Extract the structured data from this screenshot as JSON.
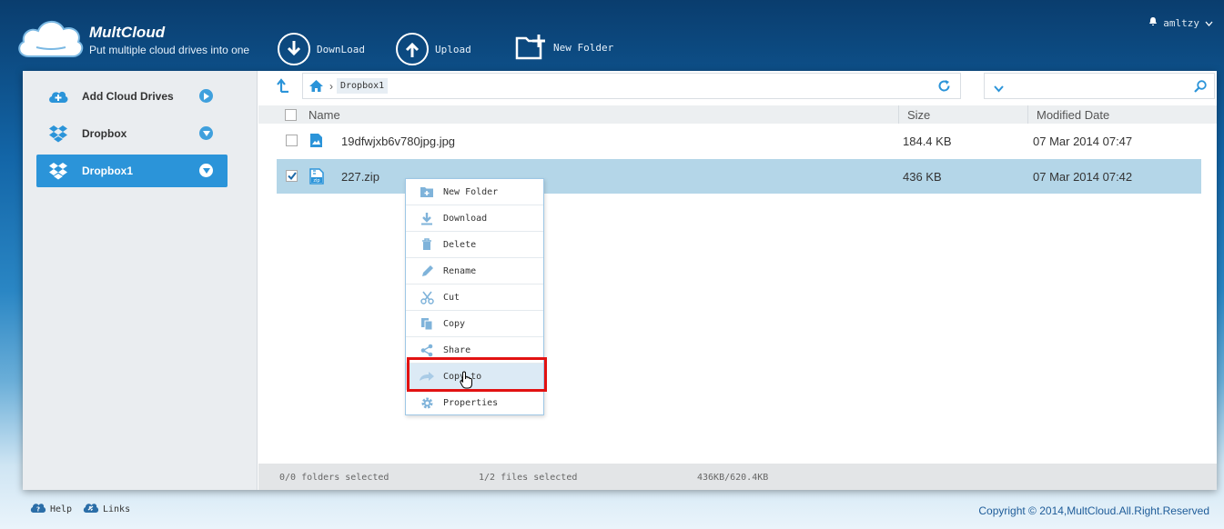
{
  "header": {
    "brand": "MultCloud",
    "tagline": "Put multiple cloud drives into one",
    "toolbar": [
      {
        "label": "DownLoad",
        "icon": "download-icon"
      },
      {
        "label": "Upload",
        "icon": "upload-icon"
      },
      {
        "label": "New Folder",
        "icon": "new-folder-icon"
      }
    ],
    "user": "amltzy"
  },
  "sidebar": {
    "items": [
      {
        "label": "Add Cloud Drives",
        "icon": "add-cloud-icon",
        "active": false
      },
      {
        "label": "Dropbox",
        "icon": "dropbox-icon",
        "active": false
      },
      {
        "label": "Dropbox1",
        "icon": "dropbox-icon",
        "active": true
      }
    ]
  },
  "path": {
    "crumb": "Dropbox1"
  },
  "search": {
    "value": ""
  },
  "table": {
    "columns": [
      "Name",
      "Size",
      "Modified Date"
    ],
    "rows": [
      {
        "name": "19dfwjxb6v780jpg.jpg",
        "size": "184.4 KB",
        "date": "07 Mar 2014 07:47",
        "checked": false,
        "icon": "image-file-icon"
      },
      {
        "name": "227.zip",
        "size": "436 KB",
        "date": "07 Mar 2014 07:42",
        "checked": true,
        "icon": "zip-file-icon"
      }
    ]
  },
  "context_menu": {
    "items": [
      {
        "label": "New Folder",
        "icon": "new-folder-icon"
      },
      {
        "label": "Download",
        "icon": "download-icon"
      },
      {
        "label": "Delete",
        "icon": "trash-icon"
      },
      {
        "label": "Rename",
        "icon": "pencil-icon"
      },
      {
        "label": "Cut",
        "icon": "scissors-icon"
      },
      {
        "label": "Copy",
        "icon": "copy-icon"
      },
      {
        "label": "Share",
        "icon": "share-icon"
      },
      {
        "label": "Copy to",
        "icon": "copy-to-icon",
        "highlighted": true
      },
      {
        "label": "Properties",
        "icon": "gear-icon"
      }
    ]
  },
  "status": {
    "folders": "0/0 folders selected",
    "files": "1/2 files selected",
    "size": "436KB/620.4KB"
  },
  "footer": {
    "help": "Help",
    "links": "Links",
    "copyright": "Copyright © 2014,MultCloud.All.Right.Reserved"
  },
  "colors": {
    "accent": "#2b94d9",
    "selected_row": "#b4d6e8",
    "highlight_box": "#e21212"
  }
}
